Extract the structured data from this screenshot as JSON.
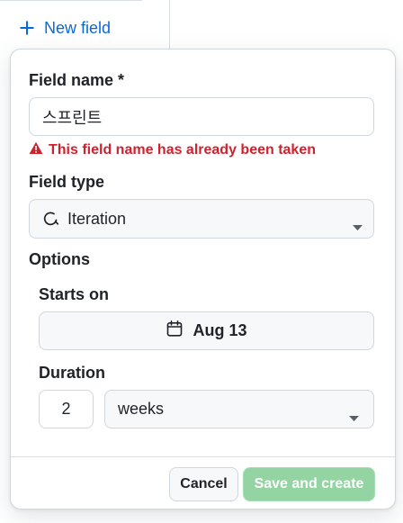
{
  "header": {
    "new_field_label": "New field"
  },
  "dialog": {
    "field_name": {
      "label": "Field name *",
      "value": "스프린트",
      "error": "This field name has already been taken"
    },
    "field_type": {
      "label": "Field type",
      "selected": "Iteration",
      "icon": "iteration-icon"
    },
    "options": {
      "label": "Options",
      "starts_on": {
        "label": "Starts on",
        "value": "Aug 13",
        "icon": "calendar-icon"
      },
      "duration": {
        "label": "Duration",
        "value": "2",
        "unit": "weeks"
      }
    },
    "footer": {
      "cancel_label": "Cancel",
      "save_label": "Save and create"
    }
  },
  "colors": {
    "accent": "#0969da",
    "error": "#cf222e",
    "primary_disabled": "#94d3a2",
    "border": "#d0d7de",
    "muted_bg": "#f6f8fa"
  }
}
